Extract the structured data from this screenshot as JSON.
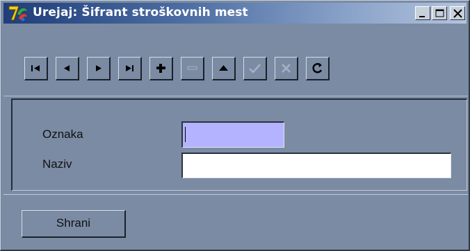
{
  "window": {
    "title": "Urejaj: Šifrant stroškovnih mest",
    "icon": "app-logo-icon",
    "controls": [
      "minimize-icon",
      "maximize-icon",
      "close-icon"
    ]
  },
  "navigator": {
    "buttons": [
      {
        "name": "first-record-icon",
        "enabled": true
      },
      {
        "name": "prior-record-icon",
        "enabled": true
      },
      {
        "name": "next-record-icon",
        "enabled": true
      },
      {
        "name": "last-record-icon",
        "enabled": true
      },
      {
        "name": "insert-record-icon",
        "enabled": true
      },
      {
        "name": "delete-record-icon",
        "enabled": false
      },
      {
        "name": "edit-record-icon",
        "enabled": true
      },
      {
        "name": "post-edit-icon",
        "enabled": false
      },
      {
        "name": "cancel-edit-icon",
        "enabled": false
      },
      {
        "name": "refresh-data-icon",
        "enabled": true
      }
    ]
  },
  "form": {
    "code_label": "Oznaka",
    "code_value": "",
    "name_label": "Naziv",
    "name_value": ""
  },
  "actions": {
    "save_label": "Shrani"
  },
  "colors": {
    "window_bg": "#7b8ba3",
    "active_field_bg": "#b3b3ff",
    "title_gradient_start": "#1e3d7a"
  }
}
